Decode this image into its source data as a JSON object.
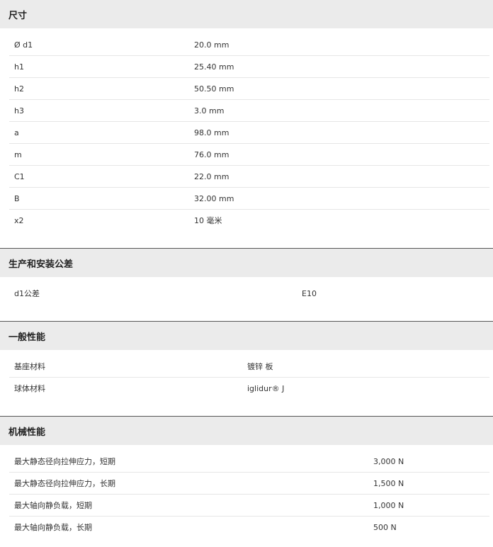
{
  "sections": [
    {
      "title": "尺寸",
      "rows": [
        {
          "label": "Ø d1",
          "value": "20.0 mm"
        },
        {
          "label": "h1",
          "value": "25.40 mm"
        },
        {
          "label": "h2",
          "value": "50.50 mm"
        },
        {
          "label": "h3",
          "value": "3.0 mm"
        },
        {
          "label": "a",
          "value": "98.0 mm"
        },
        {
          "label": "m",
          "value": "76.0 mm"
        },
        {
          "label": "C1",
          "value": "22.0 mm"
        },
        {
          "label": "B",
          "value": "32.00 mm"
        },
        {
          "label": "x2",
          "value": "10 毫米"
        }
      ]
    },
    {
      "title": "生产和安装公差",
      "rows": [
        {
          "label": "d1公差",
          "value": "E10"
        }
      ]
    },
    {
      "title": "一般性能",
      "rows": [
        {
          "label": "基座材料",
          "value": "镀锌 板"
        },
        {
          "label": "球体材料",
          "value": "iglidur® J"
        }
      ]
    },
    {
      "title": "机械性能",
      "rows": [
        {
          "label": "最大静态径向拉伸应力，短期",
          "value": "3,000 N"
        },
        {
          "label": "最大静态径向拉伸应力，长期",
          "value": "1,500 N"
        },
        {
          "label": "最大轴向静负载，短期",
          "value": "1,000 N"
        },
        {
          "label": "最大轴向静负载，长期",
          "value": "500 N"
        }
      ]
    }
  ]
}
